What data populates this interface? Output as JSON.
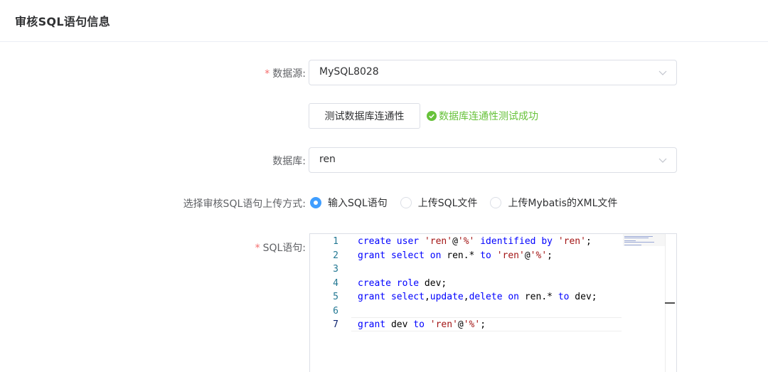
{
  "header": {
    "title": "审核SQL语句信息"
  },
  "form": {
    "datasource": {
      "label": "数据源:",
      "value": "MySQL8028"
    },
    "test_button": {
      "label": "测试数据库连通性"
    },
    "test_result": {
      "text": "数据库连通性测试成功",
      "color": "#67c23a"
    },
    "database": {
      "label": "数据库:",
      "value": "ren"
    },
    "upload_mode": {
      "label": "选择审核SQL语句上传方式:",
      "options": [
        {
          "label": "输入SQL语句",
          "selected": true
        },
        {
          "label": "上传SQL文件",
          "selected": false
        },
        {
          "label": "上传Mybatis的XML文件",
          "selected": false
        }
      ]
    },
    "sql": {
      "label": "SQL语句:"
    }
  },
  "editor": {
    "line_numbers": [
      "1",
      "2",
      "3",
      "4",
      "5",
      "6",
      "7"
    ],
    "active_line": "7",
    "lines": [
      "create user 'ren'@'%' identified by 'ren';",
      "grant select on ren.* to 'ren'@'%';",
      "",
      "create role dev;",
      "grant select,update,delete on ren.* to dev;",
      "",
      "grant dev to 'ren'@'%';"
    ]
  },
  "colors": {
    "required": "#f56c6c",
    "primary": "#409eff",
    "keyword": "#0000ff",
    "string": "#a31515"
  }
}
